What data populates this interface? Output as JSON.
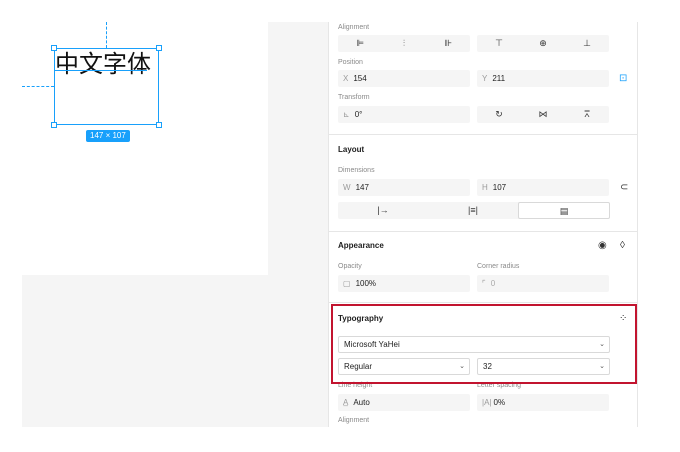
{
  "canvas": {
    "text_content": "中文字体",
    "size_badge": "147 × 107"
  },
  "alignment": {
    "label": "Alignment",
    "buttons_left": [
      "⊫",
      "⫶",
      "⊪"
    ],
    "buttons_right": [
      "⊤",
      "⊕",
      "⊥"
    ]
  },
  "position": {
    "label": "Position",
    "x_prefix": "X",
    "x_value": "154",
    "y_prefix": "Y",
    "y_value": "211"
  },
  "transform": {
    "label": "Transform",
    "rotation_prefix": "⊾",
    "rotation_value": "0°"
  },
  "layout": {
    "title": "Layout",
    "dimensions_label": "Dimensions",
    "w_prefix": "W",
    "w_value": "147",
    "h_prefix": "H",
    "h_value": "107",
    "resize_options": [
      "|→",
      "|≡|",
      "▤"
    ]
  },
  "appearance": {
    "title": "Appearance",
    "opacity_label": "Opacity",
    "opacity_value": "100%",
    "corner_label": "Corner radius",
    "corner_value": "0"
  },
  "typography": {
    "title": "Typography",
    "font_family": "Microsoft YaHei",
    "font_weight": "Regular",
    "font_size": "32",
    "line_height_label": "Line height",
    "line_height_value": "Auto",
    "letter_spacing_label": "Letter spacing",
    "letter_spacing_prefix": "|A|",
    "letter_spacing_value": "0%"
  },
  "alignment_bottom_label": "Alignment",
  "colors": {
    "accent": "#18a0fb",
    "highlight": "#c2142f"
  }
}
